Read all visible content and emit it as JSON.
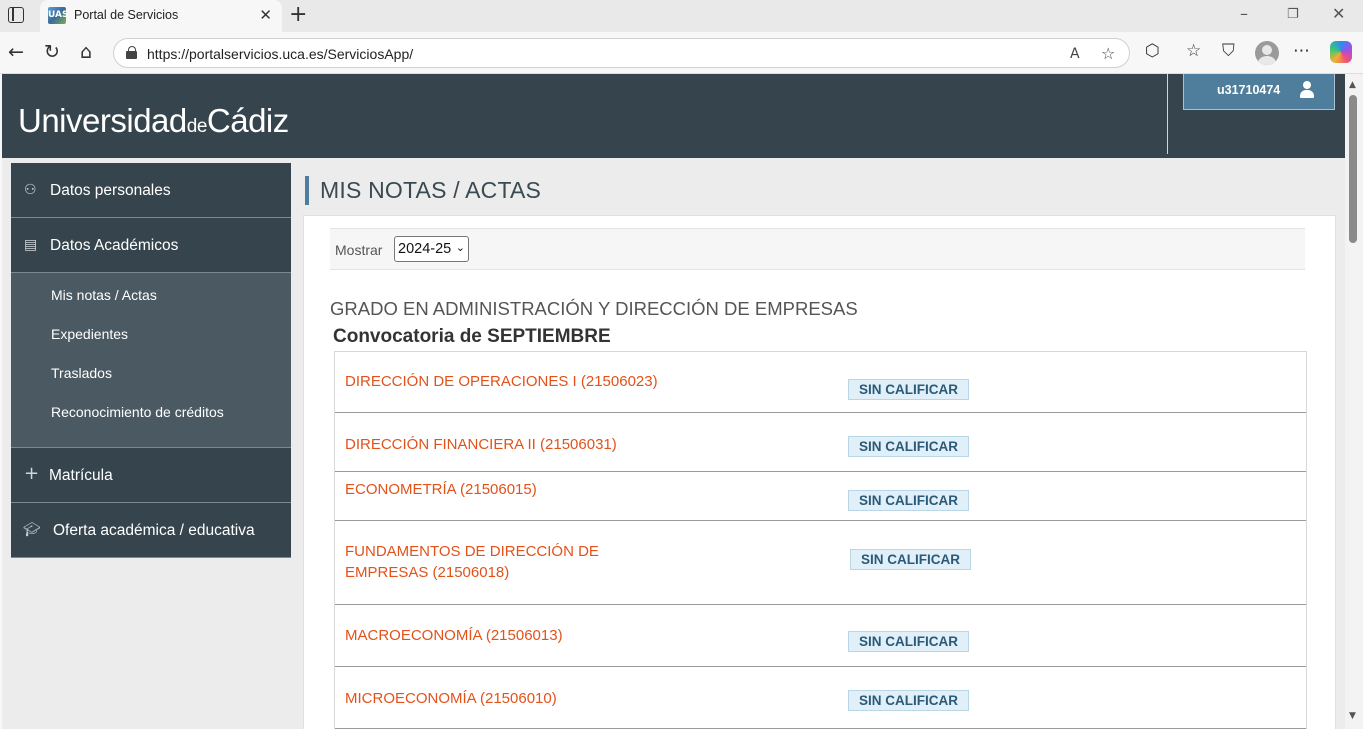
{
  "browser": {
    "tab_title": "Portal de Servicios",
    "favicon_text": "UAS",
    "url": "https://portalservicios.uca.es/ServiciosApp/"
  },
  "header": {
    "logo_prefix": "Universidad",
    "logo_middle": "de",
    "logo_suffix": "Cádiz",
    "username": "u31710474"
  },
  "sidebar": {
    "items": [
      {
        "label": "Datos personales",
        "icon": "person-icon"
      },
      {
        "label": "Datos Académicos",
        "icon": "calendar-icon"
      }
    ],
    "subitems": [
      {
        "label": "Mis notas / Actas"
      },
      {
        "label": "Expedientes"
      },
      {
        "label": "Traslados"
      },
      {
        "label": "Reconocimiento de créditos"
      }
    ],
    "bottom_items": [
      {
        "label": "Matrícula",
        "icon": "plus-icon"
      },
      {
        "label": "Oferta académica / educativa",
        "icon": "graduation-cap-icon"
      }
    ]
  },
  "main": {
    "title": "MIS NOTAS / ACTAS",
    "filter_label": "Mostrar",
    "filter_value": "2024-25",
    "degree": "GRADO EN ADMINISTRACIÓN Y DIRECCIÓN DE EMPRESAS",
    "convocatoria": "Convocatoria de SEPTIEMBRE",
    "grades": [
      {
        "subject": "DIRECCIÓN DE OPERACIONES I (21506023)",
        "status": "SIN CALIFICAR"
      },
      {
        "subject": "DIRECCIÓN FINANCIERA II (21506031)",
        "status": "SIN CALIFICAR"
      },
      {
        "subject": "ECONOMETRÍA (21506015)",
        "status": "SIN CALIFICAR"
      },
      {
        "subject": "FUNDAMENTOS DE DIRECCIÓN DE EMPRESAS (21506018)",
        "status": "SIN CALIFICAR"
      },
      {
        "subject": "MACROECONOMÍA (21506013)",
        "status": "SIN CALIFICAR"
      },
      {
        "subject": "MICROECONOMÍA (21506010)",
        "status": "SIN CALIFICAR"
      }
    ]
  },
  "colors": {
    "header_bg": "#36454d",
    "accent": "#4f7d9c",
    "subject_text": "#e2521a",
    "status_bg": "#e1f0f8"
  }
}
